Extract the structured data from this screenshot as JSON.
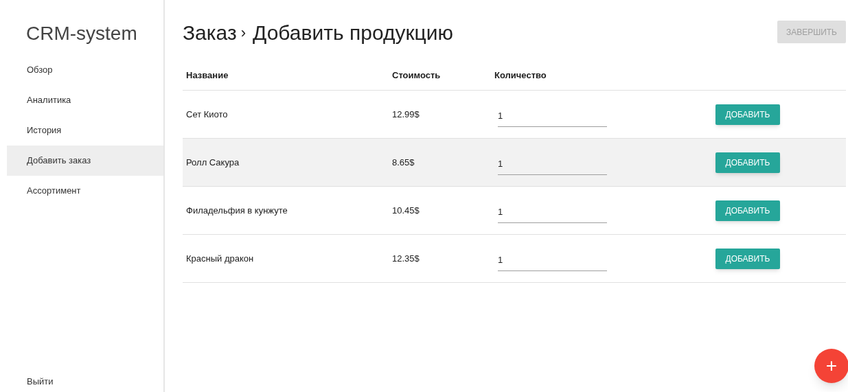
{
  "sidebar": {
    "title": "CRM-system",
    "items": [
      {
        "label": "Обзор",
        "selected": false
      },
      {
        "label": "Аналитика",
        "selected": false
      },
      {
        "label": "История",
        "selected": false
      },
      {
        "label": "Добавить заказ",
        "selected": true
      },
      {
        "label": "Ассортимент",
        "selected": false
      }
    ],
    "logout": "Выйти"
  },
  "header": {
    "breadcrumb": "Заказ",
    "separator": "›",
    "title": "Добавить продукцию",
    "finish_button": {
      "label": "ЗАВЕРШИТЬ",
      "disabled": true
    }
  },
  "table": {
    "columns": [
      "Название",
      "Стоимость",
      "Количество"
    ],
    "rows": [
      {
        "name": "Сет Киото",
        "price": "12.99$",
        "quantity": "1",
        "button": "ДОБАВИТЬ",
        "selected": false
      },
      {
        "name": "Ролл Сакура",
        "price": "8.65$",
        "quantity": "1",
        "button": "ДОБАВИТЬ",
        "selected": true
      },
      {
        "name": "Филадельфия в кунжуте",
        "price": "10.45$",
        "quantity": "1",
        "button": "ДОБАВИТЬ",
        "selected": false
      },
      {
        "name": "Красный дракон",
        "price": "12.35$",
        "quantity": "1",
        "button": "ДОБАВИТЬ",
        "selected": false
      }
    ]
  },
  "fab": {
    "label": "+"
  }
}
